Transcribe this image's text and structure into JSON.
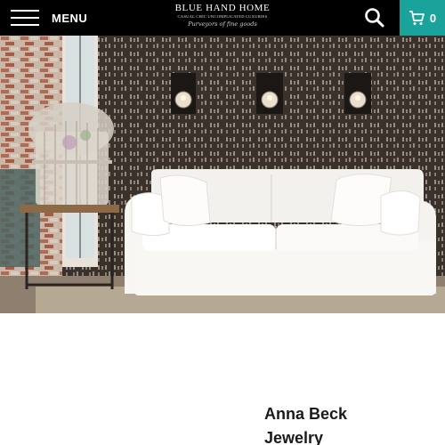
{
  "header": {
    "menu_label": "MENU",
    "logo": {
      "name": "BLUE HAND HOME",
      "tagline": "CASUAL CHIC UNCOMPLICATED LUXURIES",
      "script": "Purveyors of fine goods"
    },
    "cart_count": "0",
    "colors": {
      "bar": "#000000",
      "cart_bg": "#1aa39a"
    }
  },
  "hero": {
    "icons": [
      "wall-sconce-icon",
      "birdcage-icon",
      "side-table-icon",
      "sofa-icon"
    ]
  },
  "product": {
    "title_line1": "Anna Beck",
    "title_line2": "Jewelry"
  }
}
